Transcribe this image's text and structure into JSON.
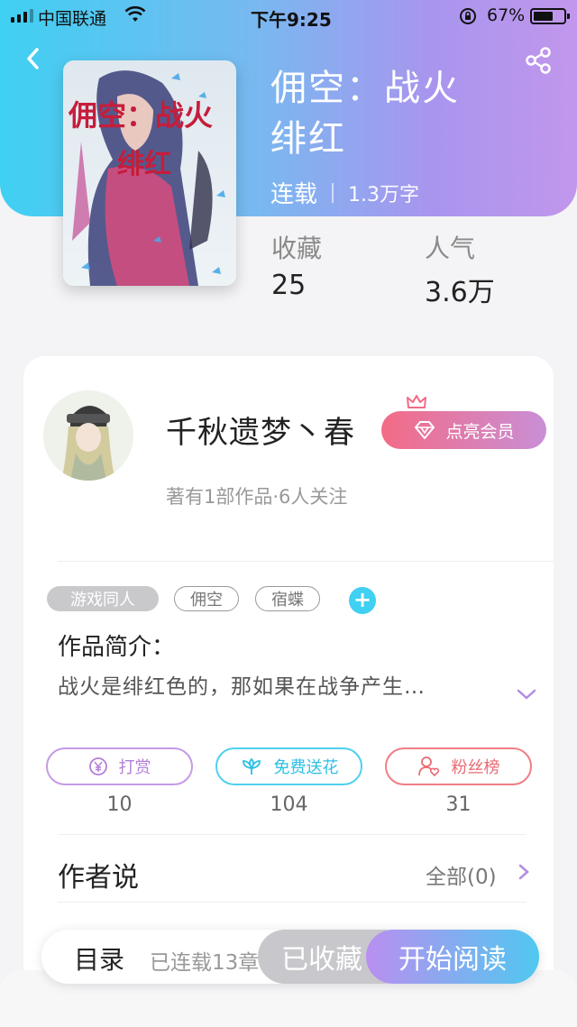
{
  "status_bar": {
    "carrier": "中国联通",
    "time": "下午9:25",
    "battery_percent": "67%",
    "battery_level": 0.67
  },
  "book": {
    "title_line1": "佣空：战火",
    "title_line2": "绯红",
    "status": "连载",
    "word_count": "1.3万字",
    "favorites_label": "收藏",
    "favorites_value": "25",
    "popularity_label": "人气",
    "popularity_value": "3.6万"
  },
  "author": {
    "name": "千秋遗梦丶春",
    "vip_button": "点亮会员",
    "subtitle": "著有1部作品·6人关注"
  },
  "tags": [
    "游戏同人",
    "佣空",
    "宿蝶"
  ],
  "intro": {
    "heading": "作品简介：",
    "text": "战火是绯红色的，那如果在战争产生…"
  },
  "actions": [
    {
      "label": "打赏",
      "count": "10",
      "icon": "yen-coin-icon"
    },
    {
      "label": "免费送花",
      "count": "104",
      "icon": "flower-icon"
    },
    {
      "label": "粉丝榜",
      "count": "31",
      "icon": "fan-user-icon"
    }
  ],
  "author_says": {
    "heading": "作者说",
    "all_label": "全部(0)"
  },
  "bottom_bar": {
    "toc": "目录",
    "serial_info": "已连载13章",
    "collected": "已收藏",
    "start_reading": "开始阅读"
  },
  "colors": {
    "header_gradient": [
      "#3fd0f2",
      "#c197ec"
    ],
    "accent_cyan": "#3fd0f2",
    "vip_gradient": [
      "#f36b86",
      "#c98fd6"
    ]
  }
}
